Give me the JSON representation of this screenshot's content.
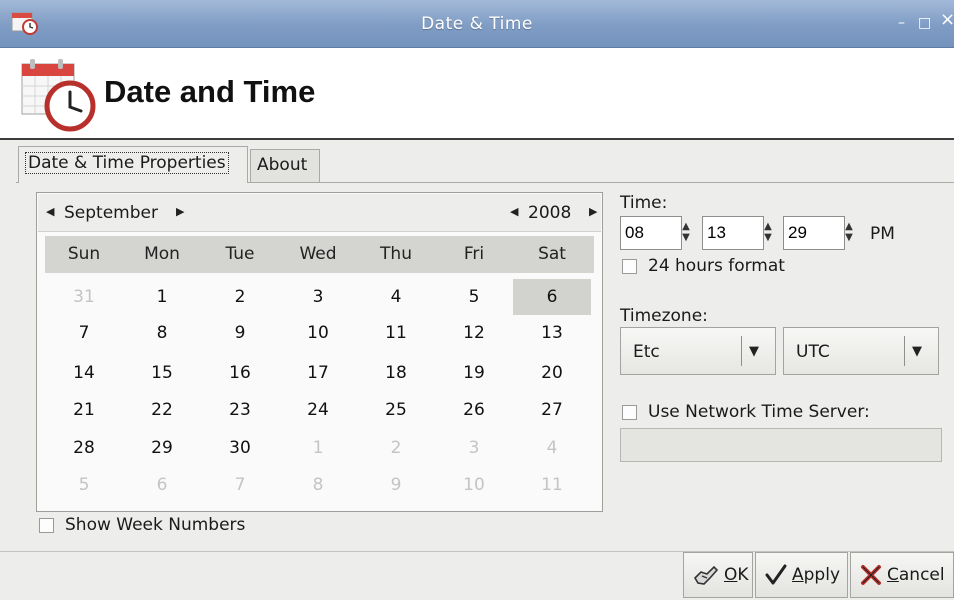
{
  "window": {
    "title": "Date & Time",
    "controls": {
      "minimize": "–",
      "maximize": "□",
      "close": "×"
    }
  },
  "header": {
    "title": "Date and Time"
  },
  "tabs": [
    {
      "label": "Date & Time Properties",
      "active": true
    },
    {
      "label": "About",
      "active": false
    }
  ],
  "calendar": {
    "month": "September",
    "year": "2008",
    "weekdays": [
      "Sun",
      "Mon",
      "Tue",
      "Wed",
      "Thu",
      "Fri",
      "Sat"
    ],
    "weeks": [
      [
        "31",
        "1",
        "2",
        "3",
        "4",
        "5",
        "6"
      ],
      [
        "7",
        "8",
        "9",
        "10",
        "11",
        "12",
        "13"
      ],
      [
        "14",
        "15",
        "16",
        "17",
        "18",
        "19",
        "20"
      ],
      [
        "21",
        "22",
        "23",
        "24",
        "25",
        "26",
        "27"
      ],
      [
        "28",
        "29",
        "30",
        "1",
        "2",
        "3",
        "4"
      ],
      [
        "5",
        "6",
        "7",
        "8",
        "9",
        "10",
        "11"
      ]
    ],
    "selected_day": "6",
    "show_week_numbers": {
      "label": "Show Week Numbers",
      "checked": false
    }
  },
  "time": {
    "label": "Time:",
    "hour": "08",
    "minute": "13",
    "second": "29",
    "ampm": "PM",
    "format_24h": {
      "label": "24 hours format",
      "checked": false
    }
  },
  "timezone": {
    "label": "Timezone:",
    "region": "Etc",
    "zone": "UTC"
  },
  "network_time": {
    "label": "Use Network Time Server:",
    "checked": false,
    "server": ""
  },
  "buttons": {
    "ok": {
      "mnemonic": "O",
      "rest": "K"
    },
    "apply": {
      "mnemonic": "A",
      "rest": "pply"
    },
    "cancel": {
      "mnemonic": "C",
      "rest": "ancel"
    }
  },
  "colors": {
    "titlebar": "#7f9cc4",
    "accent_red": "#c23a34",
    "selected_day_bg": "#d2d3cf"
  }
}
